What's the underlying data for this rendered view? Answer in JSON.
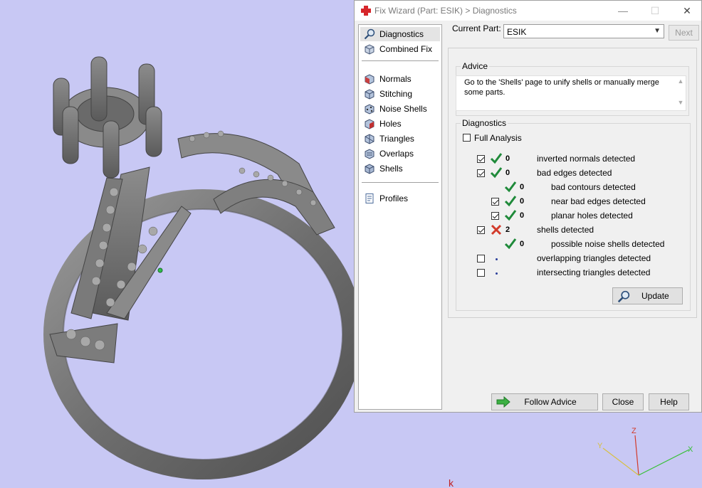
{
  "dialog": {
    "title": "Fix Wizard (Part: ESIK) > Diagnostics",
    "window_buttons": {
      "minimize": "—",
      "maximize": "☐",
      "close": "✕"
    }
  },
  "nav": {
    "items": [
      {
        "label": "Diagnostics",
        "icon": "magnifier-icon",
        "selected": true
      },
      {
        "label": "Combined Fix",
        "icon": "combined-fix-icon"
      },
      {
        "label": "Normals",
        "icon": "normals-cube-icon"
      },
      {
        "label": "Stitching",
        "icon": "stitching-cube-icon"
      },
      {
        "label": "Noise Shells",
        "icon": "noise-shells-icon"
      },
      {
        "label": "Holes",
        "icon": "holes-cube-icon"
      },
      {
        "label": "Triangles",
        "icon": "triangles-cube-icon"
      },
      {
        "label": "Overlaps",
        "icon": "overlaps-cube-icon"
      },
      {
        "label": "Shells",
        "icon": "shells-cube-icon"
      },
      {
        "label": "Profiles",
        "icon": "profiles-doc-icon"
      }
    ]
  },
  "current_part": {
    "label": "Current Part:",
    "value": "ESIK",
    "next_label": "Next"
  },
  "advice": {
    "title": "Advice",
    "text": "Go to the 'Shells' page to unify shells or manually merge some parts."
  },
  "diagnostics": {
    "title": "Diagnostics",
    "full_analysis_label": "Full Analysis",
    "rows": [
      {
        "count": "0",
        "label": "inverted normals detected",
        "status": "ok"
      },
      {
        "count": "0",
        "label": "bad edges detected",
        "status": "ok"
      },
      {
        "count": "0",
        "label": "bad contours detected",
        "status": "ok"
      },
      {
        "count": "0",
        "label": "near bad edges detected",
        "status": "ok"
      },
      {
        "count": "0",
        "label": "planar holes detected",
        "status": "ok"
      },
      {
        "count": "2",
        "label": "shells detected",
        "status": "error"
      },
      {
        "count": "0",
        "label": "possible noise shells detected",
        "status": "ok"
      },
      {
        "count": "",
        "label": "overlapping triangles detected",
        "status": "pending"
      },
      {
        "count": "",
        "label": "intersecting triangles detected",
        "status": "pending"
      }
    ],
    "update_label": "Update"
  },
  "footer": {
    "follow_advice_label": "Follow Advice",
    "close_label": "Close",
    "help_label": "Help"
  },
  "axes": {
    "x": "X",
    "y": "Y",
    "z": "Z"
  },
  "colors": {
    "viewport": "#c8c8f4",
    "ok": "#1f8a3a",
    "error": "#d23a2a",
    "accent": "#d6262b"
  }
}
